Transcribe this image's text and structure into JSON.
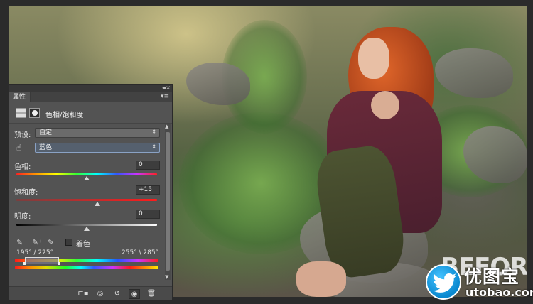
{
  "panel": {
    "tab_label": "属性",
    "menu_icon": "panel-menu-icon",
    "title": "色相/饱和度",
    "preset_label": "预设:",
    "preset_value": "自定",
    "channel_value": "蓝色",
    "hue_label": "色相:",
    "hue_value": "0",
    "saturation_label": "饱和度:",
    "saturation_value": "+15",
    "lightness_label": "明度:",
    "lightness_value": "0",
    "colorize_label": "着色",
    "range_left": "195° / 225°",
    "range_right": "255° \\ 285°",
    "hue_level": 0.5,
    "saturation_level": 0.575,
    "lightness_level": 0.5,
    "colorize_checked": false
  },
  "photo": {
    "overlay_text": "BEFORE"
  },
  "watermark": {
    "brand_cn": "优图宝",
    "brand_en": "utobao.com",
    "colors": {
      "circle": "#1a9be0",
      "text": "#ffffff"
    }
  },
  "icons": [
    "hue-saturation-icon",
    "mask-icon",
    "hand-target-icon",
    "eyedropper-icon",
    "eyedropper-plus-icon",
    "eyedropper-minus-icon",
    "clip-to-layer-icon",
    "view-previous-icon",
    "reset-icon",
    "visibility-icon",
    "trash-icon",
    "twitter-bird-icon"
  ]
}
